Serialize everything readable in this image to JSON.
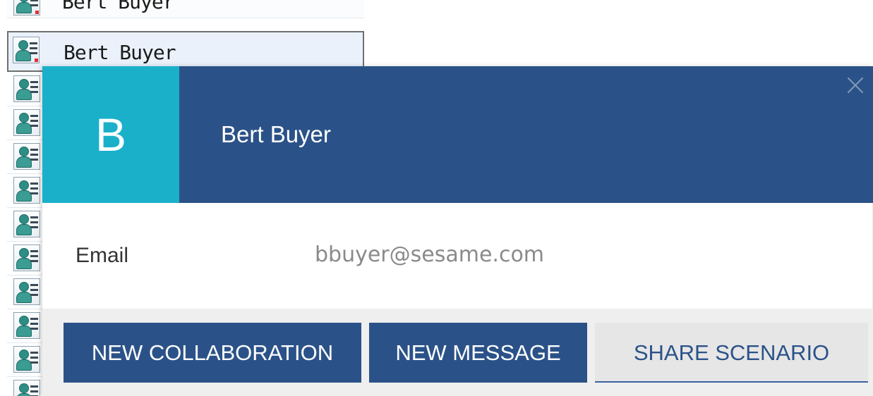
{
  "contact_list": {
    "items": [
      {
        "name": "Bert Buyer"
      },
      {
        "name": "Bert Buyer"
      }
    ]
  },
  "contact_card": {
    "avatar_letter": "B",
    "name": "Bert Buyer",
    "fields": {
      "email_label": "Email",
      "email_value": "bbuyer@sesame.com"
    },
    "actions": {
      "new_collaboration": "NEW COLLABORATION",
      "new_message": "NEW MESSAGE",
      "share_scenario": "SHARE SCENARIO"
    }
  },
  "icons": {
    "contact": "contact-card-icon",
    "close": "close-icon"
  },
  "colors": {
    "header": "#2b5288",
    "avatar": "#1ab0ca",
    "secondary_button": "#e6e6e6"
  }
}
